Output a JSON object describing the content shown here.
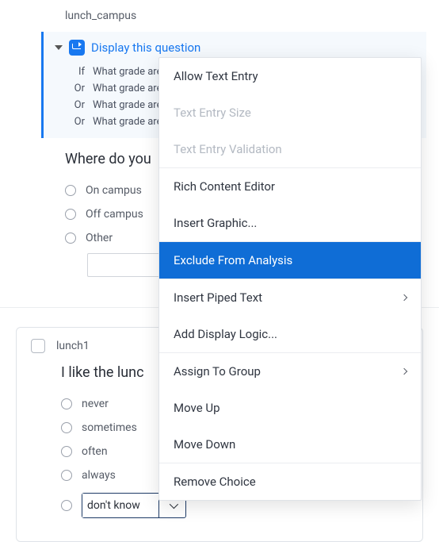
{
  "question_a": {
    "id": "lunch_campus",
    "display_logic": {
      "title": "Display this question",
      "conditions": [
        {
          "op": "If",
          "text": "What grade are y"
        },
        {
          "op": "Or",
          "text": "What grade are y"
        },
        {
          "op": "Or",
          "text": "What grade are y"
        },
        {
          "op": "Or",
          "text": "What grade are y"
        }
      ]
    },
    "text": "Where do you",
    "choices": [
      "On campus",
      "Off campus",
      "Other"
    ]
  },
  "question_b": {
    "id": "lunch1",
    "text": "I like the lunc",
    "choices": [
      "never",
      "sometimes",
      "often",
      "always"
    ],
    "editing_value": "don't know"
  },
  "context_menu": {
    "items": [
      {
        "label": "Allow Text Entry",
        "disabled": false,
        "submenu": false
      },
      {
        "label": "Text Entry Size",
        "disabled": true,
        "submenu": false
      },
      {
        "label": "Text Entry Validation",
        "disabled": true,
        "submenu": false
      },
      {
        "label": "Rich Content Editor",
        "disabled": false,
        "submenu": false,
        "sep": true
      },
      {
        "label": "Insert Graphic...",
        "disabled": false,
        "submenu": false
      },
      {
        "label": "Exclude From Analysis",
        "disabled": false,
        "submenu": false,
        "highlighted": true,
        "sep": true
      },
      {
        "label": "Insert Piped Text",
        "disabled": false,
        "submenu": true,
        "sep": true
      },
      {
        "label": "Add Display Logic...",
        "disabled": false,
        "submenu": false
      },
      {
        "label": "Assign To Group",
        "disabled": false,
        "submenu": true,
        "sep": true
      },
      {
        "label": "Move Up",
        "disabled": false,
        "submenu": false
      },
      {
        "label": "Move Down",
        "disabled": false,
        "submenu": false
      },
      {
        "label": "Remove Choice",
        "disabled": false,
        "submenu": false,
        "sep": true
      }
    ]
  }
}
